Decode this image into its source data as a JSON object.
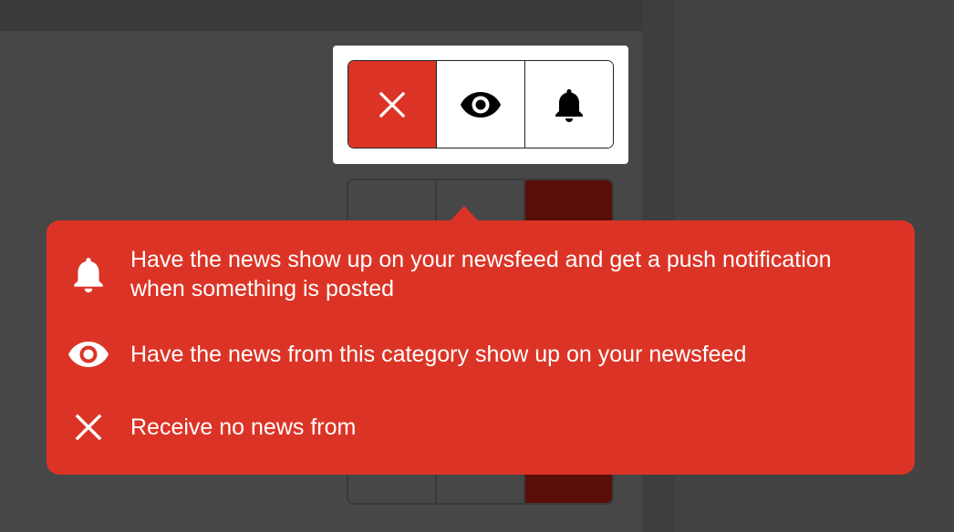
{
  "toggle_group": {
    "options": [
      {
        "name": "none",
        "icon": "close-icon",
        "active": true
      },
      {
        "name": "feed",
        "icon": "eye-icon",
        "active": false
      },
      {
        "name": "push",
        "icon": "bell-icon",
        "active": false
      }
    ]
  },
  "tooltip": {
    "items": [
      {
        "icon": "bell-icon",
        "text": "Have the news show up on your newsfeed and get a push notification when something is posted"
      },
      {
        "icon": "eye-icon",
        "text": "Have the news from this category show up on your newsfeed"
      },
      {
        "icon": "close-icon",
        "text": "Receive no news from"
      }
    ]
  },
  "colors": {
    "accent": "#db3426",
    "overlay": "#414141",
    "text_on_accent": "#ffffff"
  }
}
